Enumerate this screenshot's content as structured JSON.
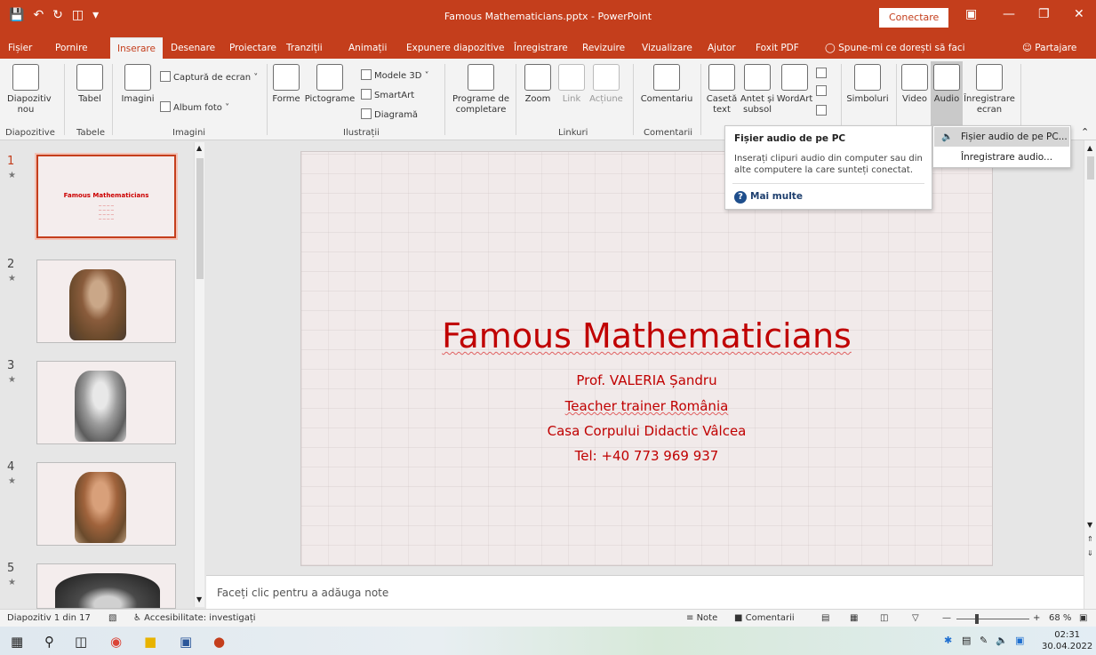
{
  "window": {
    "title": "Famous Mathematicians.pptx - PowerPoint",
    "connect_label": "Conectare",
    "accent": "#c43e1c"
  },
  "tabs": [
    {
      "label": "Fișier"
    },
    {
      "label": "Pornire"
    },
    {
      "label": "Inserare"
    },
    {
      "label": "Desenare"
    },
    {
      "label": "Proiectare"
    },
    {
      "label": "Tranziții"
    },
    {
      "label": "Animații"
    },
    {
      "label": "Expunere diapozitive"
    },
    {
      "label": "Înregistrare"
    },
    {
      "label": "Revizuire"
    },
    {
      "label": "Vizualizare"
    },
    {
      "label": "Ajutor"
    },
    {
      "label": "Foxit PDF"
    }
  ],
  "tell_me": "Spune-mi ce dorești să faci",
  "share": "Partajare",
  "ribbon": {
    "new_slide": "Diapozitiv nou",
    "table": "Tabel",
    "images": "Imagini",
    "screenshot": "Captură de ecran",
    "photo_album": "Album foto",
    "shapes": "Forme",
    "icons": "Pictograme",
    "models3d": "Modele 3D",
    "smartart": "SmartArt",
    "chart": "Diagramă",
    "addins": "Programe de completare",
    "zoom": "Zoom",
    "link": "Link",
    "action": "Acțiune",
    "comment": "Comentariu",
    "textbox": "Casetă text",
    "header_footer": "Antet și subsol",
    "wordart": "WordArt",
    "symbols": "Simboluri",
    "video": "Video",
    "audio": "Audio",
    "screen_record": "Înregistrare ecran",
    "groups": {
      "slides": "Diapozitive",
      "tables": "Tabele",
      "images": "Imagini",
      "illustrations": "Ilustrații",
      "links": "Linkuri",
      "comments": "Comentarii"
    }
  },
  "tooltip": {
    "title": "Fișier audio de pe PC",
    "description": "Inserați clipuri audio din computer sau din alte computere la care sunteți conectat.",
    "more": "Mai multe"
  },
  "audio_menu": {
    "items": [
      {
        "label": "Fișier audio de pe PC..."
      },
      {
        "label": "Înregistrare audio..."
      }
    ]
  },
  "thumbnails": [
    {
      "num": "1",
      "title": "Famous Mathematicians"
    },
    {
      "num": "2"
    },
    {
      "num": "3"
    },
    {
      "num": "4"
    },
    {
      "num": "5"
    }
  ],
  "slide": {
    "title": "Famous Mathematicians",
    "lines": [
      "Prof. VALERIA Șandru",
      "Teacher trainer România",
      "Casa Corpului Didactic Vâlcea",
      "Tel: +40 773 969 937"
    ],
    "text_color": "#c00000"
  },
  "notes_placeholder": "Faceți clic pentru a adăuga note",
  "status": {
    "slide_count": "Diapozitiv 1 din 17",
    "accessibility": "Accesibilitate: investigați",
    "notes": "Note",
    "comments": "Comentarii",
    "zoom": "68 %"
  },
  "clock": {
    "time": "02:31",
    "date": "30.04.2022"
  }
}
